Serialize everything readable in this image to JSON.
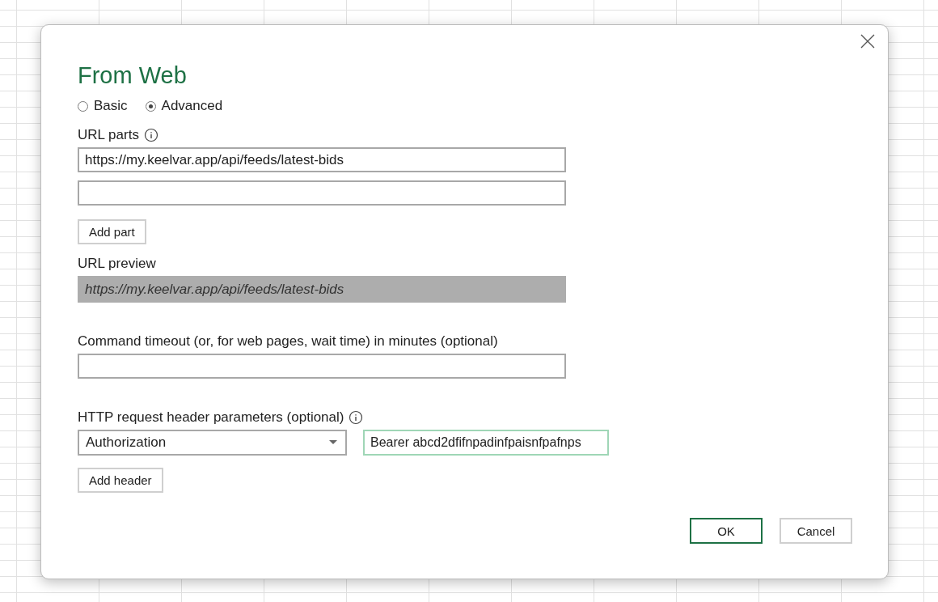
{
  "dialog": {
    "title": "From Web",
    "modes": [
      {
        "label": "Basic",
        "selected": false
      },
      {
        "label": "Advanced",
        "selected": true
      }
    ],
    "url_parts": {
      "label": "URL parts",
      "parts": [
        {
          "value": "https://my.keelvar.app/api/feeds/latest-bids"
        }
      ],
      "add_button": "Add part"
    },
    "url_preview": {
      "label": "URL preview",
      "value": "https://my.keelvar.app/api/feeds/latest-bids"
    },
    "timeout": {
      "label": "Command timeout (or, for web pages, wait time) in minutes (optional)"
    },
    "headers": {
      "label": "HTTP request header parameters (optional)",
      "rows": [
        {
          "name": "Authorization",
          "value": "Bearer abcd2dfifnpadinfpaisnfpafnps",
          "focused": true
        }
      ],
      "add_button": "Add header"
    },
    "buttons": [
      {
        "label": "OK",
        "default": true
      },
      {
        "label": "Cancel",
        "default": false
      }
    ]
  }
}
